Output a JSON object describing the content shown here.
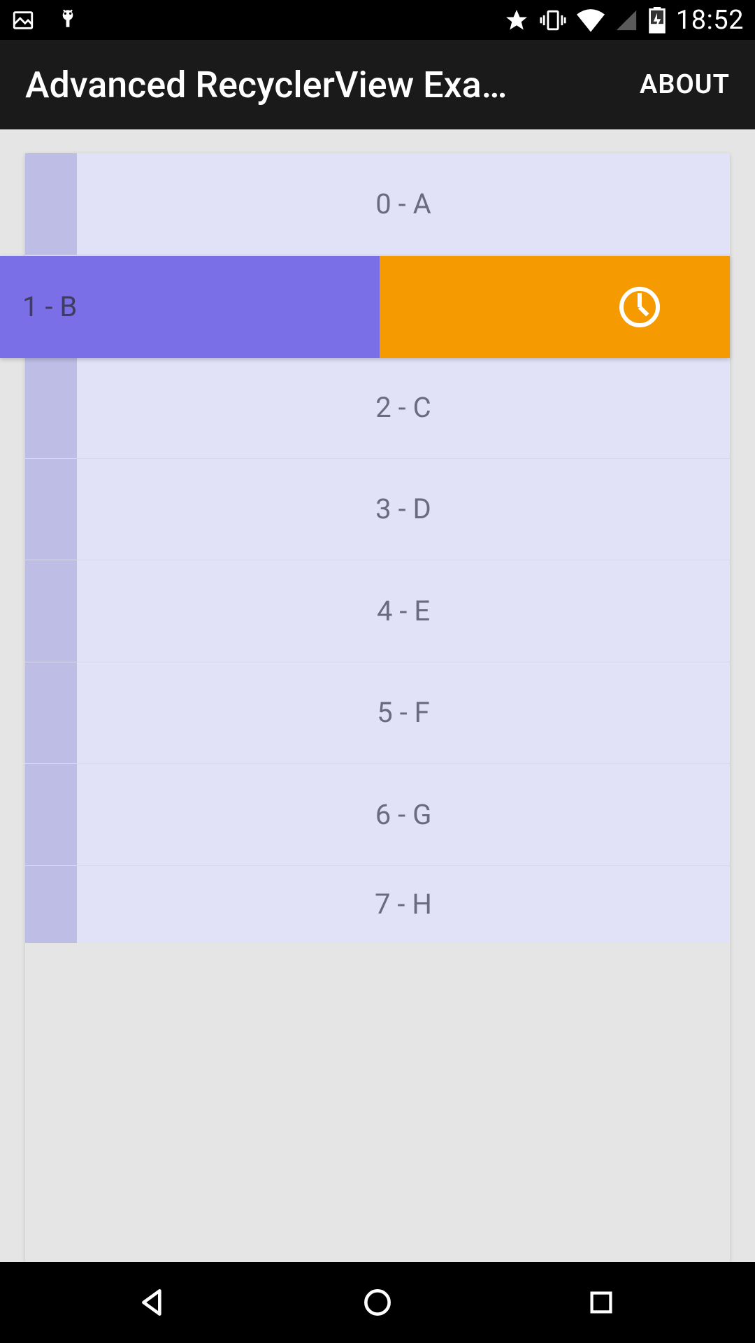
{
  "status_bar": {
    "time": "18:52",
    "icons": {
      "image": "image-icon",
      "debug": "android-debug-icon",
      "star": "star-icon",
      "vibrate": "vibrate-icon",
      "wifi": "wifi-icon",
      "cell": "cell-icon",
      "battery": "battery-charging-icon"
    }
  },
  "app_bar": {
    "title": "Advanced RecyclerView Exa…",
    "about_label": "ABOUT"
  },
  "list": {
    "items": [
      {
        "label": "0 - A",
        "swiped": false
      },
      {
        "label": "1 - B",
        "swiped": true
      },
      {
        "label": "2 - C",
        "swiped": false
      },
      {
        "label": "3 - D",
        "swiped": false
      },
      {
        "label": "4 - E",
        "swiped": false
      },
      {
        "label": "5 - F",
        "swiped": false
      },
      {
        "label": "6 - G",
        "swiped": false
      },
      {
        "label": "7 - H",
        "swiped": false
      }
    ],
    "swipe_action_icon": "clock-icon"
  },
  "colors": {
    "row_bg": "#e1e1f7",
    "handle_bg": "#bdbde6",
    "swipe_front": "#7a6fe6",
    "swipe_back": "#f59a00",
    "app_bar": "#1a1a1a"
  }
}
